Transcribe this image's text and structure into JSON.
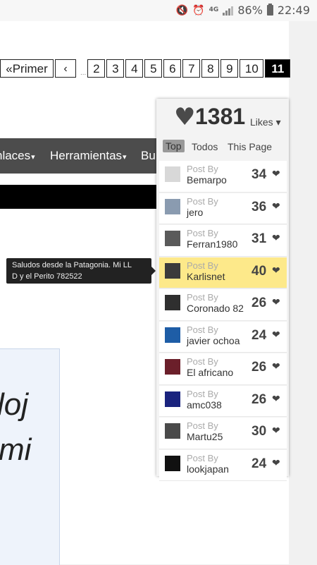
{
  "status_bar": {
    "network": "4G",
    "battery": "86%",
    "time": "22:49"
  },
  "pagination": {
    "first_label": "«Primer",
    "prev_label": "‹",
    "ellipsis": "...",
    "pages": [
      "2",
      "3",
      "4",
      "5",
      "6",
      "7",
      "8",
      "9",
      "10"
    ],
    "current": "11"
  },
  "menu": {
    "items": [
      "nlaces",
      "Herramientas",
      "Bu"
    ],
    "caret": "▾"
  },
  "tooltip": {
    "line1": "Saludos desde la Patagonia. Mi LL",
    "line2": "D y el Perito 782522"
  },
  "text_panel": {
    "line1": "loj",
    "line2": "mi"
  },
  "likes_widget": {
    "heart": "♥",
    "count": "1381",
    "likes_label": "Likes ▾",
    "tabs": [
      "Top",
      "Todos",
      "This Page"
    ],
    "active_tab": "Top",
    "post_by_label": "Post By",
    "rows": [
      {
        "user": "Bemarpo",
        "score": "34",
        "thumb_color": "#d8d8d8",
        "highlight": false
      },
      {
        "user": "jero",
        "score": "36",
        "thumb_color": "#8a9bb0",
        "highlight": false
      },
      {
        "user": "Ferran1980",
        "score": "31",
        "thumb_color": "#5a5a5a",
        "highlight": false
      },
      {
        "user": "Karlisnet",
        "score": "40",
        "thumb_color": "#3b3b3b",
        "highlight": true
      },
      {
        "user": "Coronado 82",
        "score": "26",
        "thumb_color": "#2f2f2f",
        "highlight": false
      },
      {
        "user": "javier ochoa",
        "score": "24",
        "thumb_color": "#1e5da6",
        "highlight": false
      },
      {
        "user": "El africano",
        "score": "26",
        "thumb_color": "#6b1f2a",
        "highlight": false
      },
      {
        "user": "amc038",
        "score": "26",
        "thumb_color": "#1a237e",
        "highlight": false
      },
      {
        "user": "Martu25",
        "score": "30",
        "thumb_color": "#4a4a4a",
        "highlight": false
      },
      {
        "user": "lookjapan",
        "score": "24",
        "thumb_color": "#111111",
        "highlight": false
      }
    ],
    "row_heart": "❤"
  }
}
